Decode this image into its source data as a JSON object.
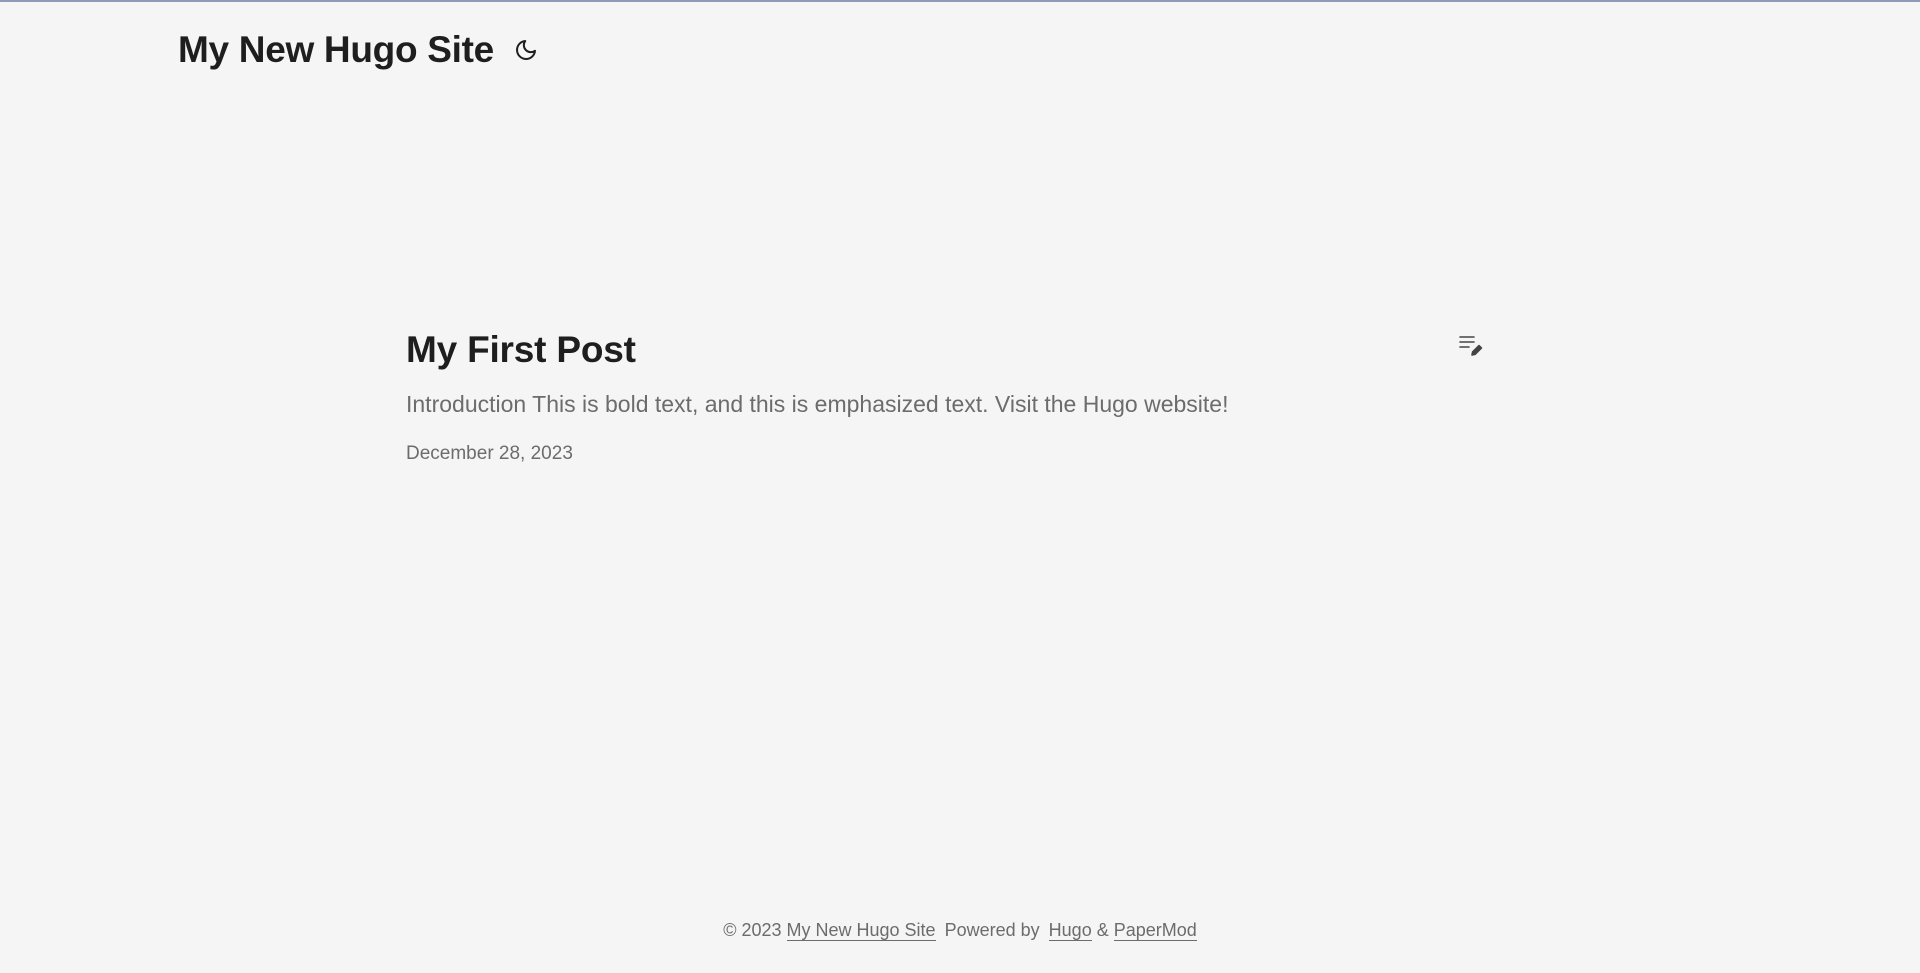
{
  "header": {
    "site_title": "My New Hugo Site",
    "theme_toggle_icon": "moon-icon"
  },
  "post": {
    "title": "My First Post",
    "summary": "Introduction This is bold text, and this is emphasized text. Visit the Hugo website!",
    "date": "December 28, 2023",
    "edit_icon": "edit-post-icon"
  },
  "footer": {
    "copyright": "© 2023",
    "site_link": "My New Hugo Site",
    "powered_by": "Powered by",
    "hugo_link": "Hugo",
    "ampersand": "&",
    "theme_link": "PaperMod"
  },
  "colors": {
    "background": "#f5f5f5",
    "text_primary": "#1e1e1e",
    "text_secondary": "#6c6c6c",
    "top_border": "#8e9cb8"
  }
}
